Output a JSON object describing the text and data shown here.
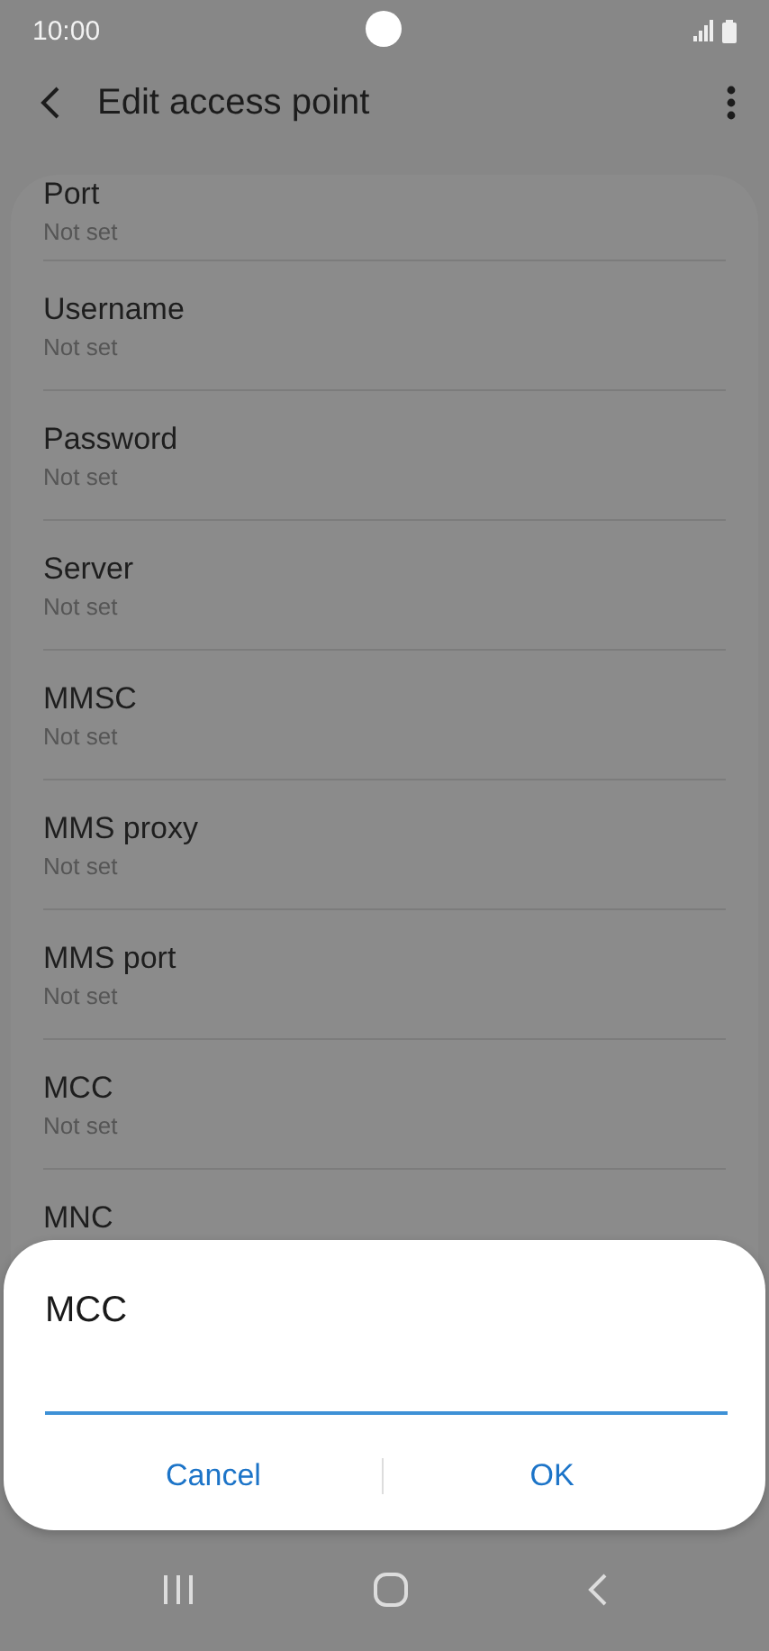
{
  "status_bar": {
    "time": "10:00"
  },
  "app_bar": {
    "title": "Edit access point"
  },
  "settings": [
    {
      "label": "Port",
      "summary": "Not set"
    },
    {
      "label": "Username",
      "summary": "Not set"
    },
    {
      "label": "Password",
      "summary": "Not set"
    },
    {
      "label": "Server",
      "summary": "Not set"
    },
    {
      "label": "MMSC",
      "summary": "Not set"
    },
    {
      "label": "MMS proxy",
      "summary": "Not set"
    },
    {
      "label": "MMS port",
      "summary": "Not set"
    },
    {
      "label": "MCC",
      "summary": "Not set"
    },
    {
      "label": "MNC"
    }
  ],
  "dialog": {
    "title": "MCC",
    "buttons": [
      "Cancel",
      "OK"
    ]
  }
}
